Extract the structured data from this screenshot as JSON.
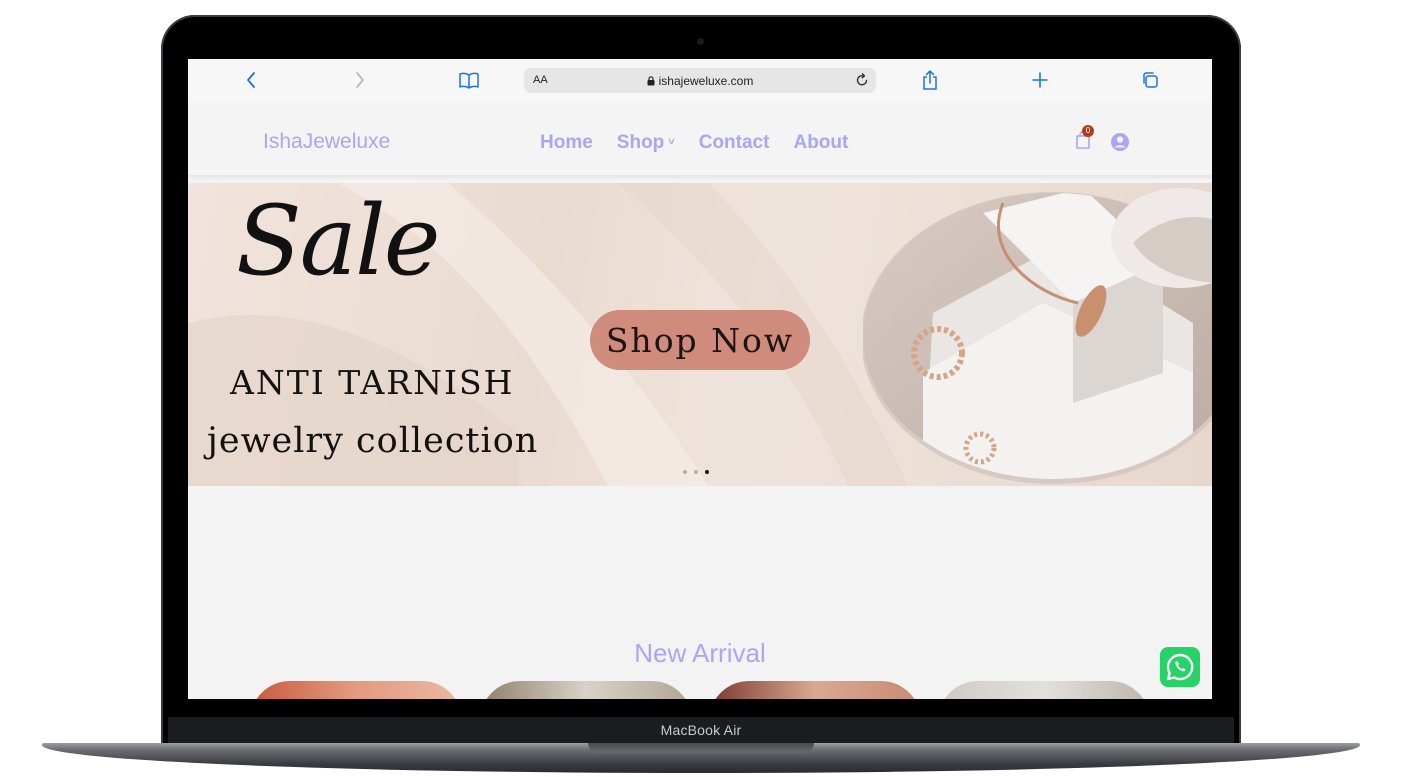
{
  "device": {
    "label": "MacBook Air"
  },
  "browser": {
    "text_size_label": "AA",
    "url": "ishajeweluxe.com",
    "icons": [
      "back-icon",
      "forward-icon",
      "bookmarks-icon",
      "lock-icon",
      "reload-icon",
      "share-icon",
      "new-tab-icon",
      "tabs-icon"
    ]
  },
  "site": {
    "logo": "IshaJeweluxe",
    "nav": [
      {
        "label": "Home"
      },
      {
        "label": "Shop",
        "has_dropdown": true,
        "chevron": "˅"
      },
      {
        "label": "Contact"
      },
      {
        "label": "About"
      }
    ],
    "cart_count": "0",
    "accent_color": "#a9a6f3"
  },
  "hero": {
    "script_word": "Sale",
    "line1": "ANTI TARNISH",
    "line2": "jewelry collection",
    "cta_label": "Shop Now",
    "cta_color": "#cf8b7b",
    "slides_total": 3,
    "active_slide": 3
  },
  "new_arrival": {
    "title": "New Arrival"
  },
  "chat": {
    "icon": "whatsapp-icon",
    "color": "#25d366"
  }
}
